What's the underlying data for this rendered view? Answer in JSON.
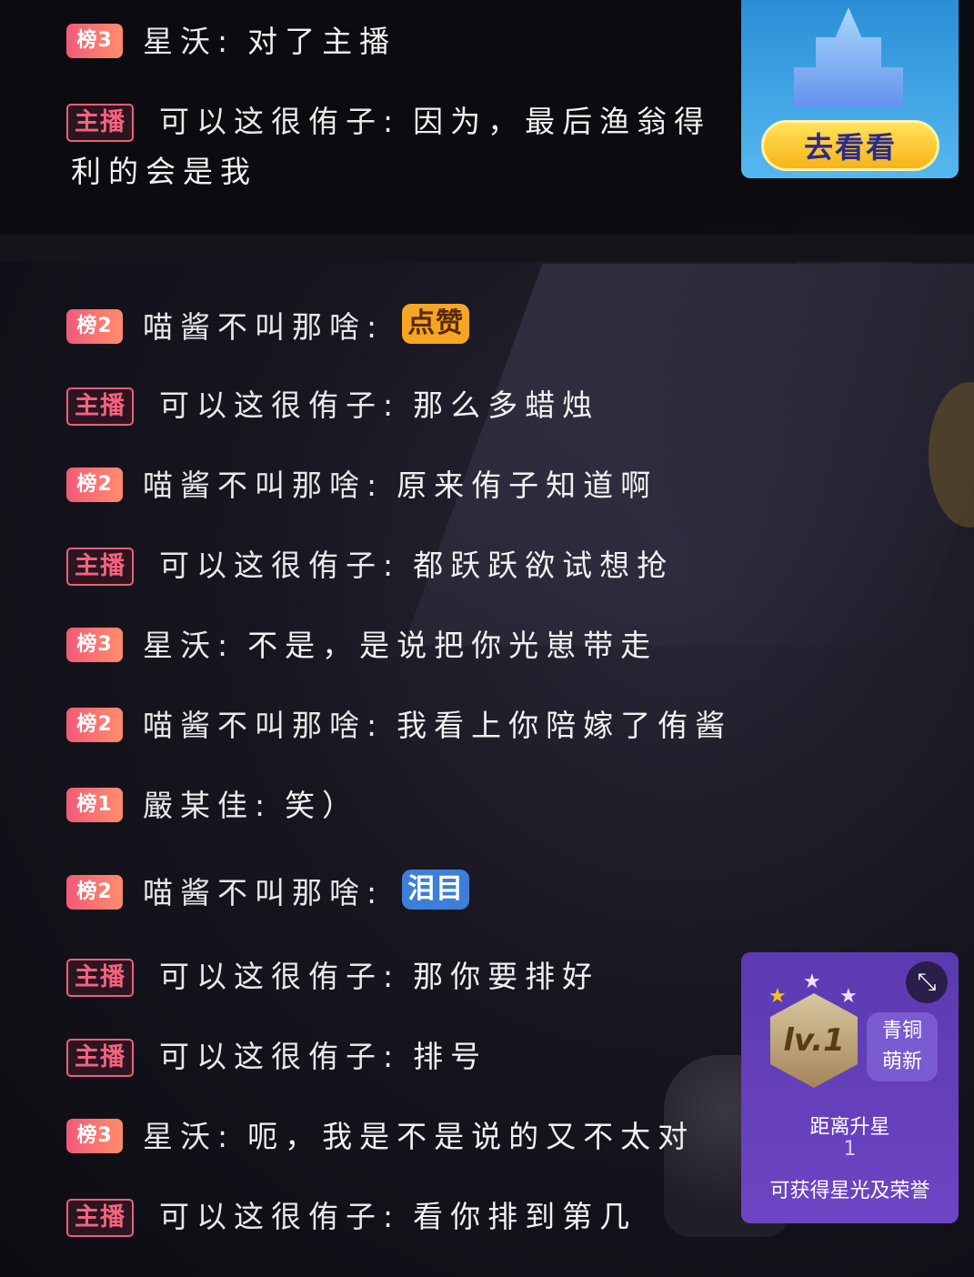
{
  "promo": {
    "button": "去看看"
  },
  "messages_top": [
    {
      "badge_type": "rank",
      "badge": "榜3",
      "name": "星沃",
      "text": "对了主播"
    },
    {
      "badge_type": "host",
      "badge": "主播",
      "name": "可以这很侑子",
      "text": "因为，最后渔翁得",
      "text_cont": "利的会是我"
    }
  ],
  "messages": [
    {
      "badge_type": "rank",
      "badge": "榜2",
      "name": "喵酱不叫那啥",
      "sticker": "点赞"
    },
    {
      "badge_type": "host",
      "badge": "主播",
      "name": "可以这很侑子",
      "text": "那么多蜡烛"
    },
    {
      "badge_type": "rank",
      "badge": "榜2",
      "name": "喵酱不叫那啥",
      "text": "原来侑子知道啊"
    },
    {
      "badge_type": "host",
      "badge": "主播",
      "name": "可以这很侑子",
      "text": "都跃跃欲试想抢"
    },
    {
      "badge_type": "rank",
      "badge": "榜3",
      "name": "星沃",
      "text": "不是，是说把你光崽带走"
    },
    {
      "badge_type": "rank",
      "badge": "榜2",
      "name": "喵酱不叫那啥",
      "text": "我看上你陪嫁了侑酱"
    },
    {
      "badge_type": "rank",
      "badge": "榜1",
      "name": "嚴某佳",
      "text": "笑）"
    },
    {
      "badge_type": "rank",
      "badge": "榜2",
      "name": "喵酱不叫那啥",
      "sticker": "泪目"
    },
    {
      "badge_type": "host",
      "badge": "主播",
      "name": "可以这很侑子",
      "text": "那你要排好"
    },
    {
      "badge_type": "host",
      "badge": "主播",
      "name": "可以这很侑子",
      "text": "排号"
    },
    {
      "badge_type": "rank",
      "badge": "榜3",
      "name": "星沃",
      "text": "呃，我是不是说的又不太对"
    },
    {
      "badge_type": "host",
      "badge": "主播",
      "name": "可以这很侑子",
      "text": "看你排到第几"
    }
  ],
  "level_card": {
    "level": "lv.1",
    "tier_line1": "青铜",
    "tier_line2": "萌新",
    "distance_label": "距离升星",
    "distance_value": "1",
    "reward_text": "可获得星光及荣誉"
  }
}
